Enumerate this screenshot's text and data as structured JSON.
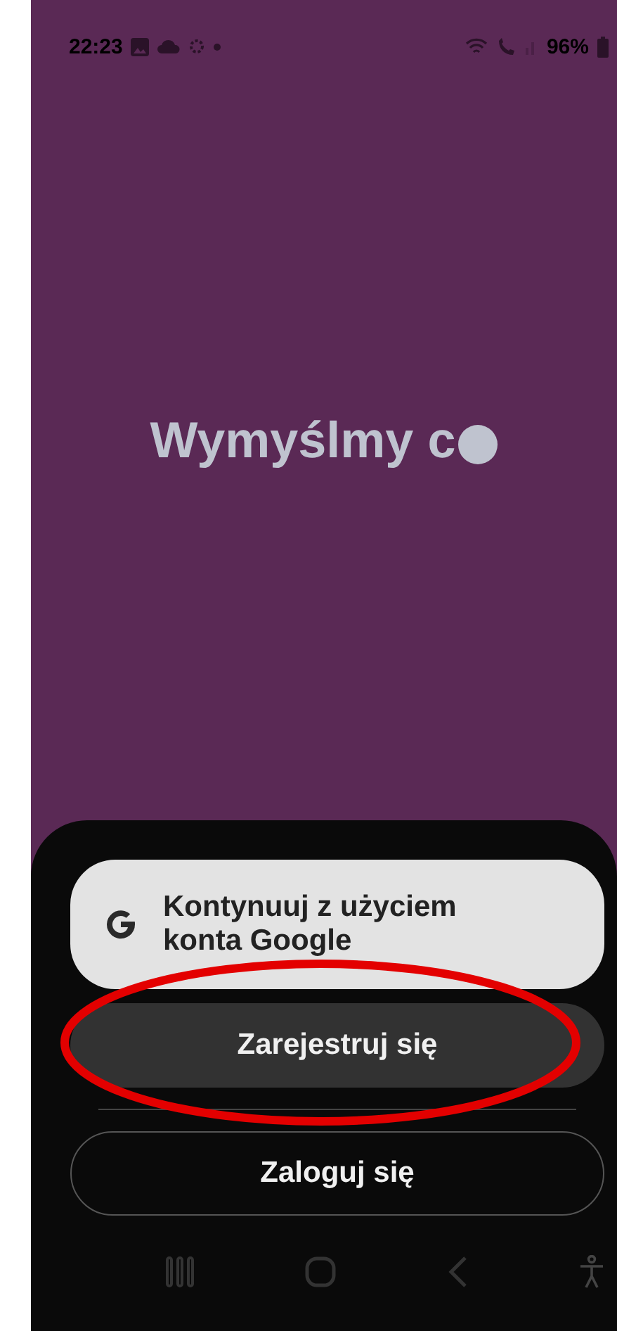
{
  "status_bar": {
    "time": "22:23",
    "battery": "96%"
  },
  "title": "Wymyślmy c",
  "buttons": [
    {
      "kind": "google",
      "label": "Kontynuuj z użyciem konta Google"
    },
    {
      "kind": "filled",
      "label": "Zarejestruj się",
      "highlighted": true
    },
    {
      "kind": "outline",
      "label": "Zaloguj się"
    }
  ]
}
